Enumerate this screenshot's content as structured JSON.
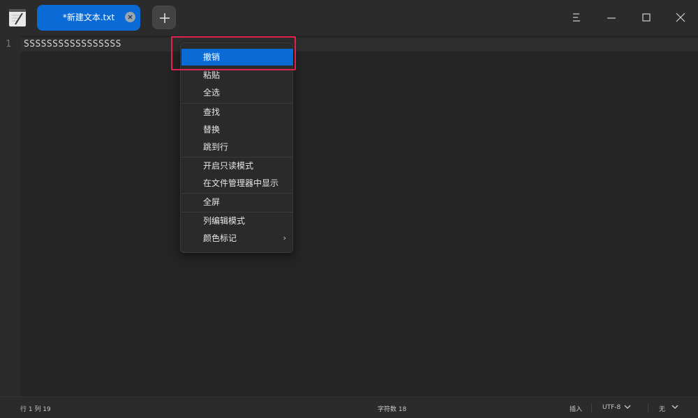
{
  "tab": {
    "title": "*新建文本.txt"
  },
  "editor": {
    "line_number": "1",
    "content": "SSSSSSSSSSSSSSSSS"
  },
  "context_menu": {
    "items": [
      "撤销",
      "粘贴",
      "全选",
      "查找",
      "替换",
      "跳到行",
      "开启只读模式",
      "在文件管理器中显示",
      "全屏",
      "列编辑模式",
      "颜色标记"
    ],
    "active_item": "撤销",
    "submenu_arrow": "›"
  },
  "statusbar": {
    "position": "行 1  列 19",
    "char_count": "字符数 18",
    "mode": "插入",
    "encoding": "UTF-8",
    "highlight": "无"
  },
  "colors": {
    "accent": "#0a6ad6",
    "highlight_box": "#e0224f"
  }
}
